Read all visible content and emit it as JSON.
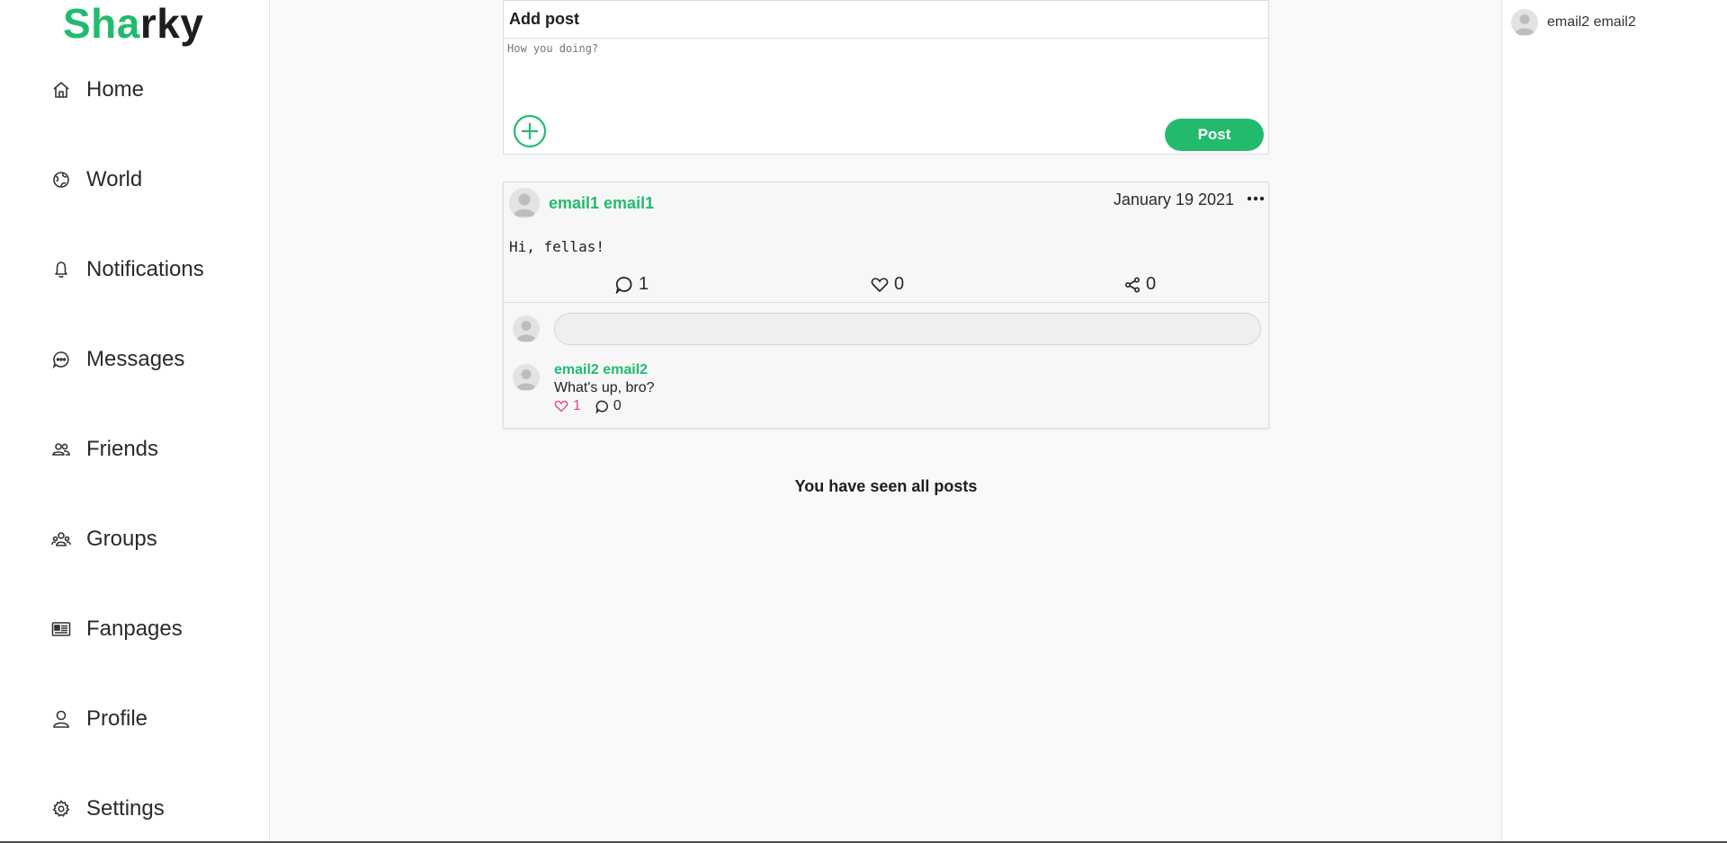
{
  "brand": {
    "part1": "Sha",
    "part2": "rky",
    "accent": "#22bb6e"
  },
  "nav": [
    {
      "label": "Home",
      "icon": "home-icon"
    },
    {
      "label": "World",
      "icon": "globe-icon"
    },
    {
      "label": "Notifications",
      "icon": "bell-icon"
    },
    {
      "label": "Messages",
      "icon": "chat-icon"
    },
    {
      "label": "Friends",
      "icon": "friends-icon"
    },
    {
      "label": "Groups",
      "icon": "groups-icon"
    },
    {
      "label": "Fanpages",
      "icon": "newspaper-icon"
    },
    {
      "label": "Profile",
      "icon": "user-icon"
    },
    {
      "label": "Settings",
      "icon": "gear-icon"
    }
  ],
  "addpost": {
    "title": "Add post",
    "placeholder": "How you doing?",
    "post_label": "Post"
  },
  "post": {
    "author": "email1 email1",
    "date": "January 19 2021",
    "body": "Hi, fellas!",
    "comments_count": "1",
    "likes_count": "0",
    "shares_count": "0",
    "comment_placeholder": "",
    "comments": [
      {
        "author": "email2 email2",
        "text": "What's up, bro?",
        "likes": "1",
        "replies": "0"
      }
    ]
  },
  "feed_end": "You have seen all posts",
  "online_users": [
    {
      "name": "email2 email2"
    }
  ]
}
